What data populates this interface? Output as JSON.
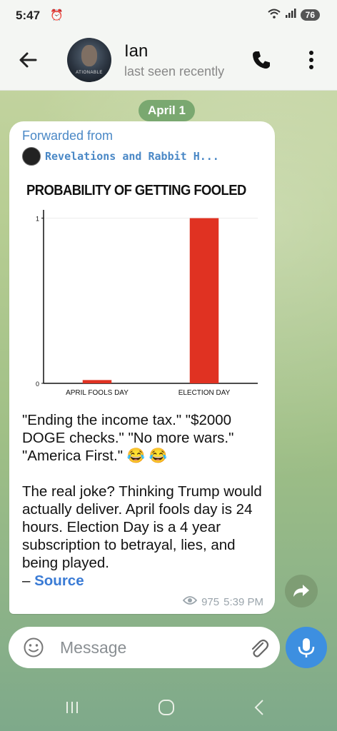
{
  "status_bar": {
    "time": "5:47",
    "battery": "76"
  },
  "header": {
    "contact_name": "Ian",
    "contact_status": "last seen recently",
    "avatar_text": "ATIONABLE"
  },
  "date_chip": "April 1",
  "message": {
    "forwarded_label": "Forwarded from",
    "forwarded_source": "Revelations and Rabbit H...",
    "paragraph1": "\"Ending the income tax.\"  \"$2000 DOGE checks.\"  \"No more wars.\" \"America First.\" 😂 😂",
    "paragraph2": "The real joke? Thinking Trump would actually deliver. April fools day is 24 hours. Election Day is a 4 year subscription to betrayal, lies, and being played.",
    "source_prefix": "– ",
    "source_link": "Source",
    "views": "975",
    "time": "5:39 PM"
  },
  "chart_data": {
    "type": "bar",
    "title": "PROBABILITY OF GETTING FOOLED",
    "categories": [
      "APRIL FOOLS DAY",
      "ELECTION DAY"
    ],
    "values": [
      0.02,
      1
    ],
    "ylim": [
      0,
      1.05
    ],
    "yticks": [
      "0",
      "1"
    ],
    "bar_color": "#e03222",
    "grid": false
  },
  "input": {
    "placeholder": "Message"
  }
}
